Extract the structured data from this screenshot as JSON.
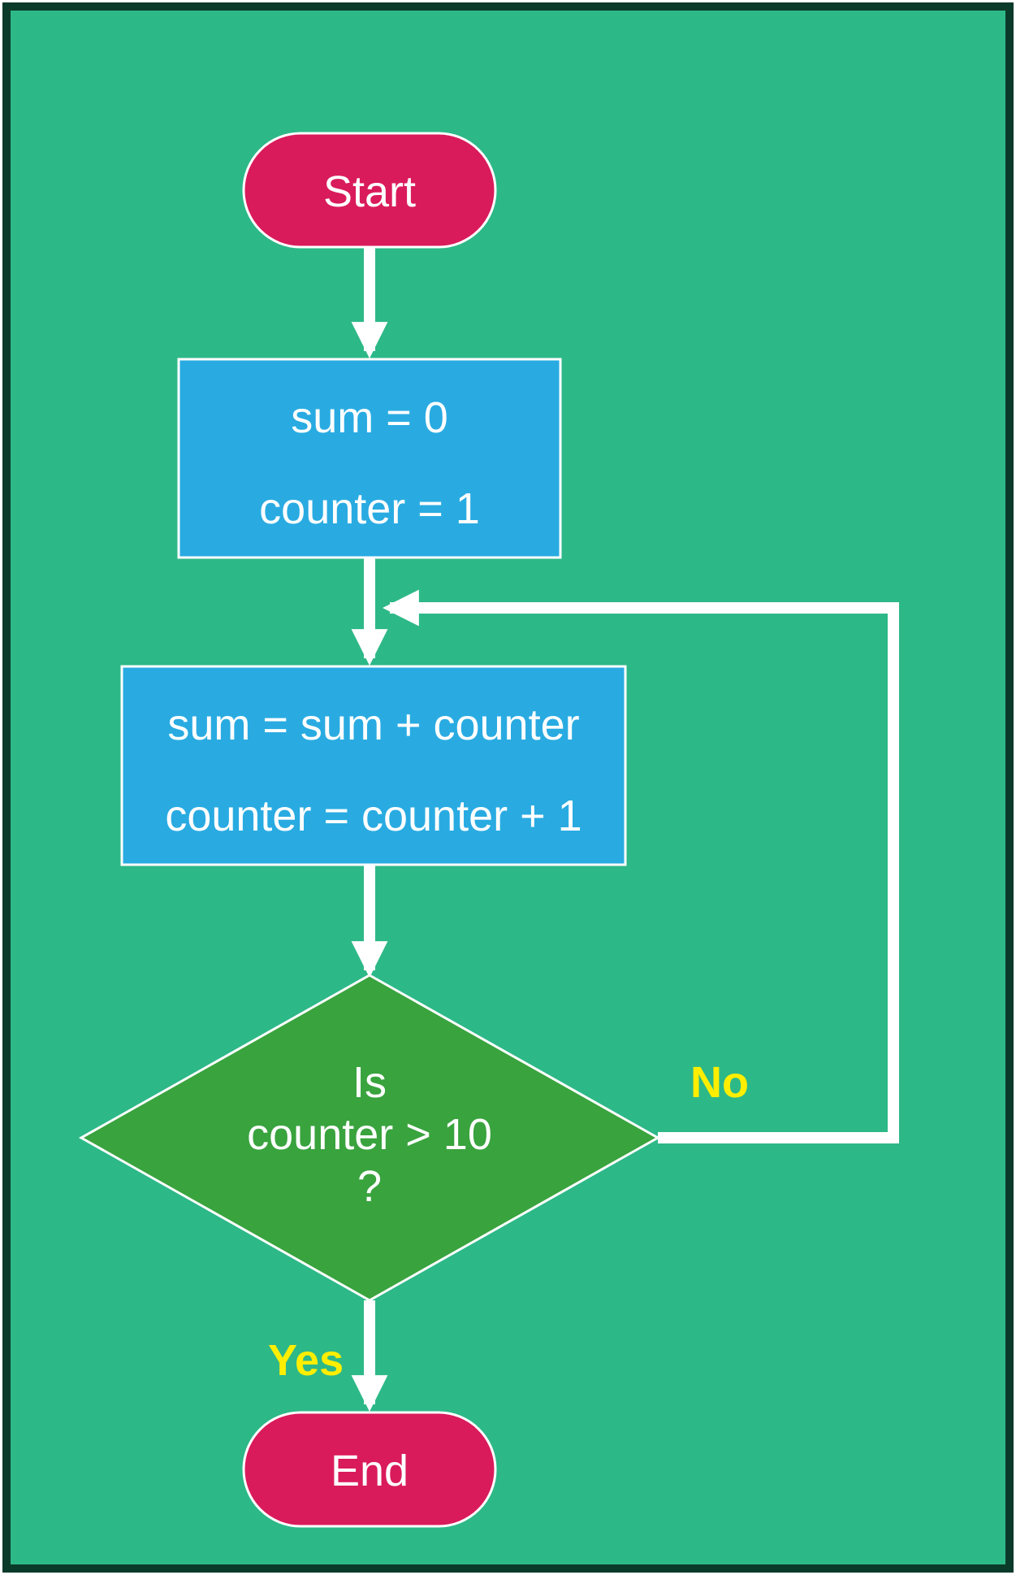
{
  "flowchart": {
    "start": {
      "label": "Start"
    },
    "init": {
      "line1": "sum = 0",
      "line2": "counter = 1"
    },
    "loop": {
      "line1": "sum = sum + counter",
      "line2": "counter = counter + 1"
    },
    "decision": {
      "line1": "Is",
      "line2": "counter > 10",
      "line3": "?"
    },
    "end": {
      "label": "End"
    },
    "branches": {
      "yes": "Yes",
      "no": "No"
    }
  },
  "colors": {
    "background": "#2db888",
    "terminator": "#d91b5c",
    "process": "#29abe2",
    "decision": "#39a33e",
    "arrow": "#ffffff",
    "branchText": "#ffee00"
  }
}
